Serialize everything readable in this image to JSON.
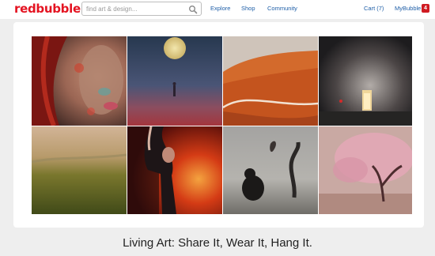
{
  "header": {
    "logo_part1": "red",
    "logo_part2": "bubble",
    "search": {
      "placeholder": "find art & design..."
    },
    "nav": {
      "explore": "Explore",
      "shop": "Shop",
      "community": "Community",
      "cart": "Cart (7)",
      "mybubble": "MyBubble",
      "notification_count": "4"
    }
  },
  "gallery": {
    "tiles": [
      {
        "subject": "painted-face-portrait"
      },
      {
        "subject": "full-moon-figure"
      },
      {
        "subject": "orange-dunes"
      },
      {
        "subject": "surreal-doorway"
      },
      {
        "subject": "misty-field"
      },
      {
        "subject": "dancer-red"
      },
      {
        "subject": "bear-and-tree"
      },
      {
        "subject": "pink-blossom-tree"
      }
    ]
  },
  "tagline": "Living Art: Share It, Wear It, Hang It.",
  "colors": {
    "brand_red": "#e41321",
    "link_blue": "#1f5fa8",
    "badge_red": "#cf1b22"
  }
}
